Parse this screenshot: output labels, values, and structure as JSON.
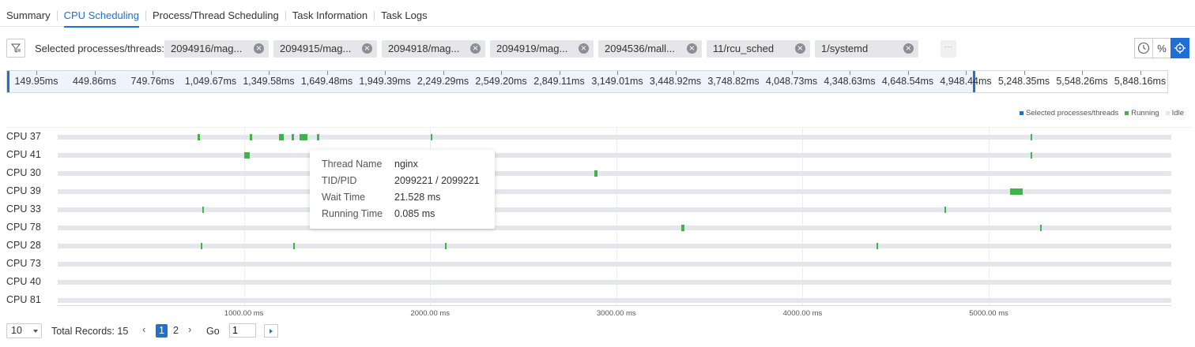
{
  "tabs": [
    {
      "label": "Summary",
      "active": false
    },
    {
      "label": "CPU Scheduling",
      "active": true
    },
    {
      "label": "Process/Thread Scheduling",
      "active": false
    },
    {
      "label": "Task Information",
      "active": false
    },
    {
      "label": "Task Logs",
      "active": false
    }
  ],
  "filter": {
    "label": "Selected processes/threads:",
    "chips": [
      "2094916/mag...",
      "2094915/mag...",
      "2094918/mag...",
      "2094919/mag...",
      "2094536/mall...",
      "11/rcu_sched",
      "1/systemd"
    ],
    "more": "···"
  },
  "toolbar": {
    "clock_icon": "clock-icon",
    "percent_label": "%",
    "locate_icon": "crosshair-icon"
  },
  "ruler": {
    "labels": [
      "149.95ms",
      "449.86ms",
      "749.76ms",
      "1,049.67ms",
      "1,349.58ms",
      "1,649.48ms",
      "1,949.39ms",
      "2,249.29ms",
      "2,549.20ms",
      "2,849.11ms",
      "3,149.01ms",
      "3,448.92ms",
      "3,748.82ms",
      "4,048.73ms",
      "4,348.63ms",
      "4,648.54ms",
      "4,948.44ms",
      "5,248.35ms",
      "5,548.26ms",
      "5,848.16ms"
    ]
  },
  "legend": [
    {
      "label": "Selected processes/threads",
      "color": "#1f6fd6"
    },
    {
      "label": "Running",
      "color": "#3fb549"
    },
    {
      "label": "Idle",
      "color": "#e3e6ea"
    }
  ],
  "colors": {
    "accent": "#1f6fd6",
    "running": "#3fb549",
    "idle": "#e3e6ea"
  },
  "chart_data": {
    "type": "timeline",
    "x_unit": "ms",
    "x_range": [
      0,
      5980
    ],
    "x_ticks": [
      "1000.00 ms",
      "2000.00 ms",
      "3000.00 ms",
      "4000.00 ms",
      "5000.00 ms"
    ],
    "rows": [
      {
        "cpu": "CPU 37",
        "running": [
          [
            750,
            765
          ],
          [
            1030,
            1045
          ],
          [
            1190,
            1215
          ],
          [
            1255,
            1270
          ],
          [
            1300,
            1340
          ],
          [
            1390,
            1405
          ],
          [
            2005,
            2012
          ],
          [
            5225,
            5232
          ]
        ]
      },
      {
        "cpu": "CPU 41",
        "running": [
          [
            1000,
            1030
          ],
          [
            5225,
            5232
          ]
        ]
      },
      {
        "cpu": "CPU 30",
        "running": [
          [
            2880,
            2900
          ]
        ]
      },
      {
        "cpu": "CPU 39",
        "running": [
          [
            5115,
            5180
          ]
        ]
      },
      {
        "cpu": "CPU 33",
        "running": [
          [
            775,
            782
          ],
          [
            4760,
            4767
          ]
        ]
      },
      {
        "cpu": "CPU 78",
        "running": [
          [
            3350,
            3365
          ],
          [
            5275,
            5282
          ]
        ]
      },
      {
        "cpu": "CPU 28",
        "running": [
          [
            770,
            777
          ],
          [
            1265,
            1272
          ],
          [
            2080,
            2087
          ],
          [
            4395,
            4402
          ]
        ]
      },
      {
        "cpu": "CPU 73",
        "running": []
      },
      {
        "cpu": "CPU 40",
        "running": []
      },
      {
        "cpu": "CPU 81",
        "running": []
      }
    ]
  },
  "tooltip": {
    "rows": [
      {
        "key": "Thread Name",
        "value": "nginx"
      },
      {
        "key": "TID/PID",
        "value": "2099221 / 2099221"
      },
      {
        "key": "Wait Time",
        "value": "21.528 ms"
      },
      {
        "key": "Running Time",
        "value": "0.085 ms"
      }
    ]
  },
  "pagination": {
    "page_size": "10",
    "total_label": "Total Records: 15",
    "pages": [
      "1",
      "2"
    ],
    "current": "1",
    "go_label": "Go",
    "go_value": "1"
  }
}
